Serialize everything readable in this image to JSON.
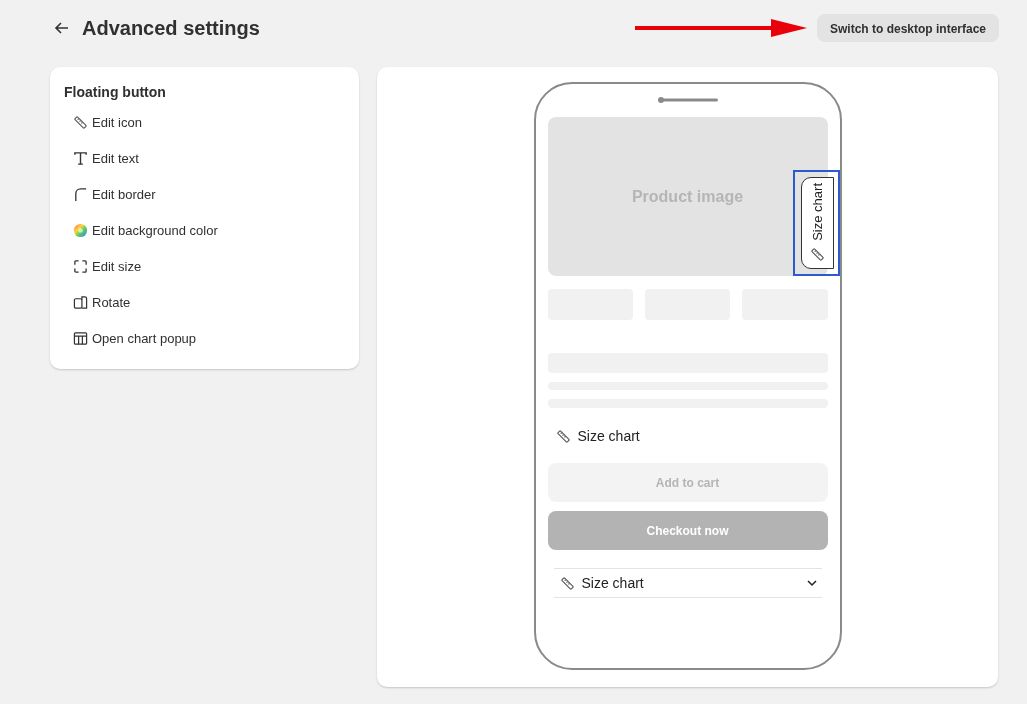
{
  "header": {
    "title": "Advanced settings",
    "switch_button": "Switch to desktop interface"
  },
  "menu": {
    "title": "Floating button",
    "items": [
      {
        "label": "Edit icon",
        "kind": "ruler"
      },
      {
        "label": "Edit text",
        "kind": "text"
      },
      {
        "label": "Edit border",
        "kind": "corner"
      },
      {
        "label": "Edit background color",
        "kind": "palette"
      },
      {
        "label": "Edit size",
        "kind": "frame"
      },
      {
        "label": "Rotate",
        "kind": "rotate"
      },
      {
        "label": "Open chart popup",
        "kind": "table"
      }
    ]
  },
  "preview": {
    "product_image": "Product image",
    "floating_button": {
      "label": "Size chart",
      "selected": true
    },
    "size_chart_link": "Size chart",
    "add_to_cart": "Add to cart",
    "checkout": "Checkout now",
    "accordion": {
      "label": "Size chart",
      "expanded": false
    }
  }
}
